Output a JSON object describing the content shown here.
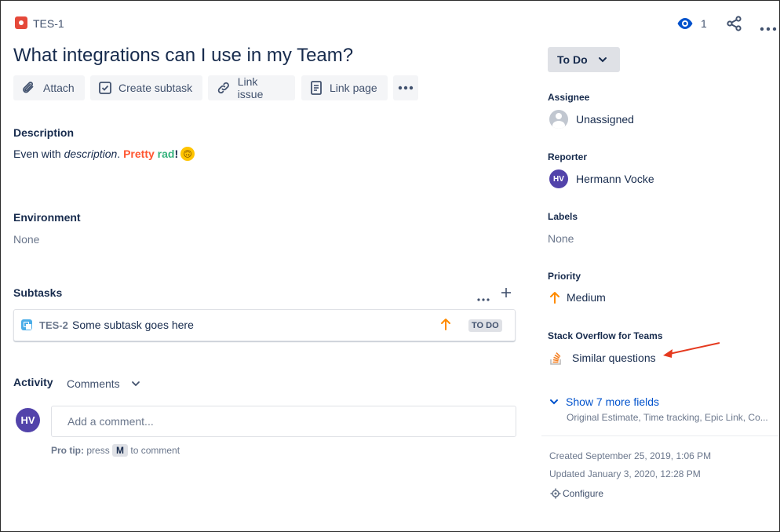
{
  "header": {
    "issue_key": "TES-1",
    "watch_count": "1",
    "title": "What integrations can I use in my Team?"
  },
  "toolbar": {
    "attach_label": "Attach",
    "create_subtask_label": "Create subtask",
    "link_issue_label": "Link issue",
    "link_page_label": "Link page"
  },
  "description": {
    "heading": "Description",
    "text_plain_1": "Even with ",
    "text_italic": "description",
    "text_plain_2": ". ",
    "text_pretty": "Pretty",
    "text_rad": "rad",
    "text_bang": "!",
    "emoji": "🙃"
  },
  "environment": {
    "heading": "Environment",
    "value": "None"
  },
  "subtasks": {
    "heading": "Subtasks",
    "items": [
      {
        "key": "TES-2",
        "summary": "Some subtask goes here",
        "status": "TO DO"
      }
    ]
  },
  "activity": {
    "heading": "Activity",
    "filter_label": "Comments",
    "avatar_initials": "HV",
    "comment_placeholder": "Add a comment...",
    "protip_label": "Pro tip:",
    "protip_text_1": "press",
    "protip_key": "M",
    "protip_text_2": "to comment"
  },
  "sidebar": {
    "status_label": "To Do",
    "assignee": {
      "label": "Assignee",
      "value": "Unassigned"
    },
    "reporter": {
      "label": "Reporter",
      "value": "Hermann Vocke",
      "initials": "HV"
    },
    "labels": {
      "label": "Labels",
      "value": "None"
    },
    "priority": {
      "label": "Priority",
      "value": "Medium"
    },
    "stackoverflow": {
      "label": "Stack Overflow for Teams",
      "value": "Similar questions"
    },
    "more_fields": {
      "label": "Show 7 more fields",
      "sub": "Original Estimate, Time tracking, Epic Link, Co..."
    },
    "created": "Created September 25, 2019, 1:06 PM",
    "updated": "Updated January 3, 2020, 12:28 PM",
    "configure": "Configure"
  },
  "colors": {
    "accent": "#0052CC",
    "pretty": "#FF5630",
    "rad": "#36B37E",
    "priority": "#FF8B00",
    "annotation_arrow": "#E5391E"
  }
}
